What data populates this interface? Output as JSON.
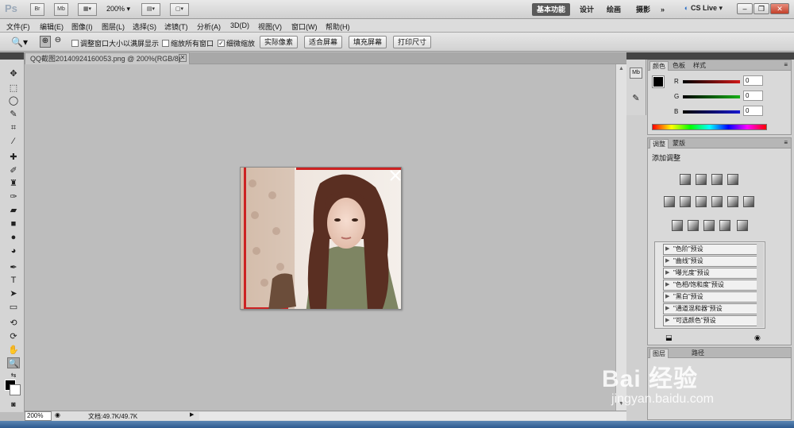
{
  "titlebar": {
    "logo": "Ps",
    "bridge": "Br",
    "minibridge": "Mb",
    "zoom": "200%",
    "workspaces": [
      "基本功能",
      "设计",
      "绘画",
      "摄影"
    ],
    "more": "»",
    "cslive": "CS Live"
  },
  "menu": [
    "文件(F)",
    "编辑(E)",
    "图像(I)",
    "图层(L)",
    "选择(S)",
    "滤镜(T)",
    "分析(A)",
    "3D(D)",
    "视图(V)",
    "窗口(W)",
    "帮助(H)"
  ],
  "options": {
    "resize_windows": "调整窗口大小以满屏显示",
    "zoom_all": "缩放所有窗口",
    "scrubby_zoom": "细微缩放",
    "actual_pixels": "实际像素",
    "fit_screen": "适合屏幕",
    "fill_screen": "填充屏幕",
    "print_size": "打印尺寸"
  },
  "document": {
    "tab_title": "QQ截图20140924160053.png @ 200%(RGB/8)",
    "zoom": "200%",
    "doc_size": "文档:49.7K/49.7K"
  },
  "color_panel": {
    "tabs": [
      "颜色",
      "色板",
      "样式"
    ],
    "channels": [
      {
        "label": "R",
        "value": "0",
        "color": "#c01818"
      },
      {
        "label": "G",
        "value": "0",
        "color": "#18a018"
      },
      {
        "label": "B",
        "value": "0",
        "color": "#1818c0"
      }
    ]
  },
  "adjust_panel": {
    "tabs": [
      "调整",
      "蒙版"
    ],
    "title": "添加调整",
    "presets": [
      "\"色阶\"预设",
      "\"曲线\"预设",
      "\"曝光度\"预设",
      "\"色相/饱和度\"预设",
      "\"黑白\"预设",
      "\"通道混和器\"预设",
      "\"可选颜色\"预设"
    ]
  },
  "layers_panel": {
    "tabs": [
      "图层",
      "路径"
    ]
  },
  "watermark": {
    "brand": "Bai 经验",
    "url": "jingyan.baidu.com"
  }
}
